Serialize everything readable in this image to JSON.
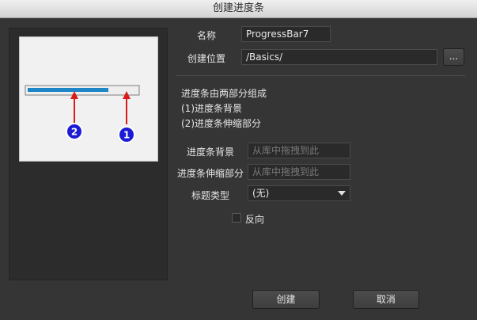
{
  "window": {
    "title": "创建进度条"
  },
  "form": {
    "name_label": "名称",
    "name_value": "ProgressBar7",
    "location_label": "创建位置",
    "location_value": "/Basics/",
    "browse_label": "..."
  },
  "info": {
    "line1": "进度条由两部分组成",
    "line2": "(1)进度条背景",
    "line3": "(2)进度条伸缩部分"
  },
  "background_field": {
    "label": "进度条背景",
    "placeholder": "从库中拖拽到此"
  },
  "stretch_field": {
    "label": "进度条伸缩部分",
    "placeholder": "从库中拖拽到此"
  },
  "title_type": {
    "label": "标题类型",
    "selected": "(无)"
  },
  "reverse": {
    "label": "反向",
    "checked": false
  },
  "buttons": {
    "create": "创建",
    "cancel": "取消"
  },
  "preview": {
    "marker1": "1",
    "marker2": "2",
    "fill_fraction": 0.74,
    "colors": {
      "track": "#eeeeee",
      "fill": "#1d86c6",
      "arrow": "#d81c1c",
      "marker": "#1b1bd6"
    }
  }
}
